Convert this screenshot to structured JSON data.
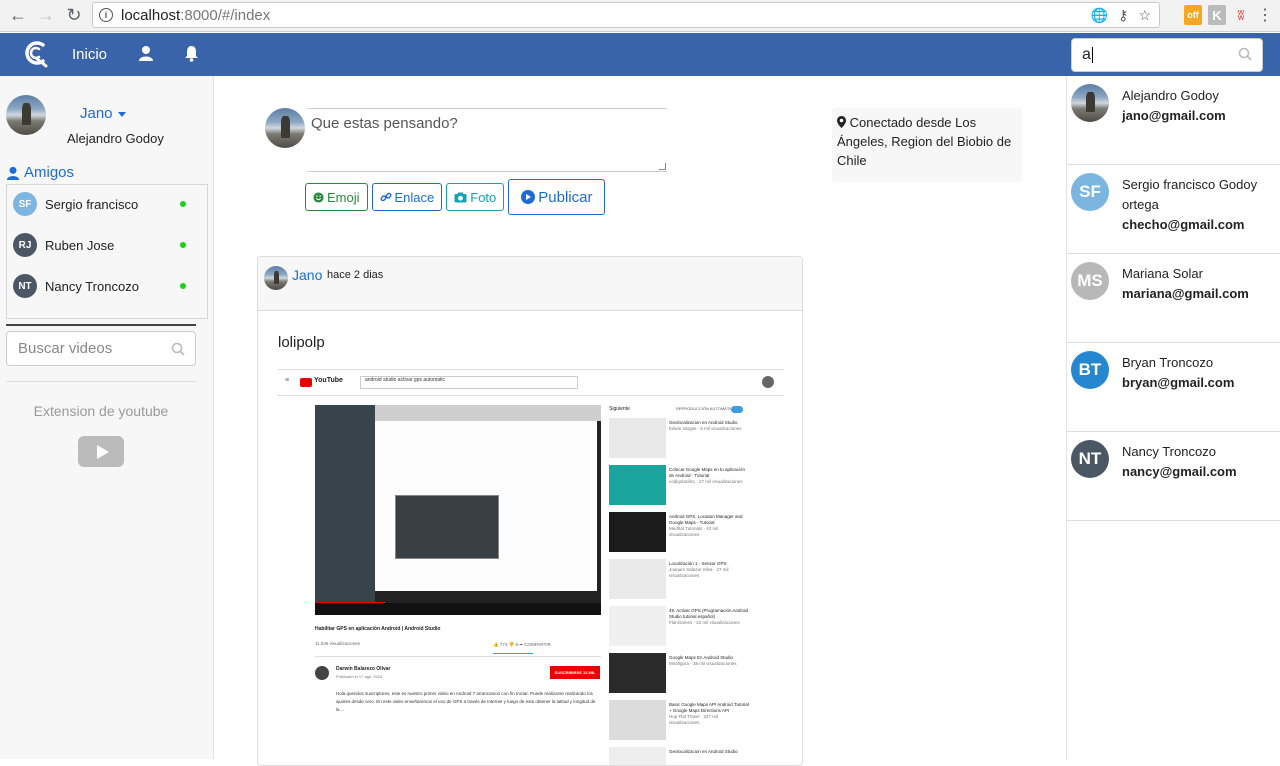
{
  "browser": {
    "url_host": "localhost",
    "url_rest": ":8000/#/index",
    "ext_off_label": "off",
    "ext_k_label": "K"
  },
  "appbar": {
    "nav_home": "Inicio",
    "search_value": "a"
  },
  "left": {
    "user_short": "Jano",
    "user_full": "Alejandro Godoy",
    "friends_title": "Amigos",
    "friends": [
      {
        "initials": "SF",
        "name": "Sergio francisco",
        "color": "#7cb6e0",
        "online": true
      },
      {
        "initials": "RJ",
        "name": "Ruben Jose",
        "color": "#4c5766",
        "online": true
      },
      {
        "initials": "NT",
        "name": "Nancy Troncozo",
        "color": "#4c5766",
        "online": true
      }
    ],
    "video_search_placeholder": "Buscar videos",
    "youtube_ext_label": "Extension de youtube"
  },
  "composer": {
    "placeholder": "Que estas pensando?",
    "btn_emoji": "Emoji",
    "btn_link": "Enlace",
    "btn_photo": "Foto",
    "btn_publish": "Publicar"
  },
  "location": {
    "text": "Conectado desde Los Ángeles, Region del Biobio de Chile"
  },
  "post": {
    "author": "Jano",
    "time": "hace 2 dias",
    "text": "lolipolp",
    "embedded": {
      "search_query": "android studio activar gps automatic",
      "video_title": "Habilitar GPS en aplicación Android | Android Studio",
      "views": "11.545 visualizaciones",
      "actions": "👍 774   👎 6   ➦ COMPARTIR",
      "channel": "Darwin Balarezo Olivar",
      "channel_date": "Publicado el 17 ago. 2016",
      "subscribe": "SUSCRIBIRSE 12 MIL",
      "desc": "Hola queridos suscriptores, este es nuestro primer video en Android 7 arrancamos con fin Iniciar. Puede realizarse realizando los ajustes desde cero. En este video enseñaremos el uso de GPS a través de Internet y luego de esta obtener la latitud y longitud de la ...",
      "side_header": "Siguiente",
      "side_auto": "REPRODUCCIÓN AUTOMÁTICA",
      "side_videos": [
        {
          "title": "Geolocalizacion en Android Studio",
          "sub": "Edwin Vargas · 6 mil visualizaciones"
        },
        {
          "title": "Colocar Google Maps en tu aplicación de Android - Tutorial",
          "sub": "codigofacilito · 27 mil visualizaciones"
        },
        {
          "title": "Android GPS, Location Manager and Google Maps - Tutorial",
          "sub": "Medhat Tutorials · 43 mil visualizaciones"
        },
        {
          "title": "Localización 1 - Sensor GPS",
          "sub": "Joaquín Salazar Silva · 27 mil visualizaciones"
        },
        {
          "title": "49. Activar GPS (Programación Android Studio tutorial español)",
          "sub": "FlanGames · 22 mil visualizaciones"
        },
        {
          "title": "Google Maps En Android Studio",
          "sub": "Mirafigura · 38 mil visualizaciones"
        },
        {
          "title": "Basic Google Maps API Android Tutorial + Google Maps Directions API",
          "sub": "Hop Flat Travel · 227 mil visualizaciones"
        },
        {
          "title": "Geolocalizacion en Android Studio",
          "sub": ""
        }
      ]
    }
  },
  "right": {
    "users": [
      {
        "photo": true,
        "name": "Alejandro Godoy",
        "email": "jano@gmail.com"
      },
      {
        "initials": "SF",
        "color": "#7cb6e0",
        "name": "Sergio francisco Godoy ortega",
        "email": "checho@gmail.com"
      },
      {
        "initials": "MS",
        "color": "#b8b8b8",
        "name": "Mariana Solar",
        "email": "mariana@gmail.com"
      },
      {
        "initials": "BT",
        "color": "#2587d0",
        "name": "Bryan Troncozo",
        "email": "bryan@gmail.com"
      },
      {
        "initials": "NT",
        "color": "#4c5766",
        "name": "Nancy Troncozo",
        "email": "nancy@gmail.com"
      }
    ]
  }
}
